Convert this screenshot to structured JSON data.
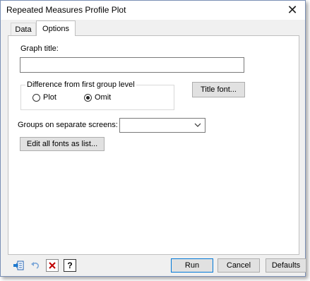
{
  "window": {
    "title": "Repeated Measures Profile Plot"
  },
  "tabs": [
    {
      "label": "Data",
      "active": false
    },
    {
      "label": "Options",
      "active": true
    }
  ],
  "options": {
    "graph_title_label": "Graph title:",
    "graph_title_value": "",
    "difference_group": {
      "legend": "Difference from first group level",
      "plot_label": "Plot",
      "omit_label": "Omit",
      "selected": "Omit"
    },
    "title_font_button": "Title font...",
    "groups_label": "Groups on separate screens:",
    "groups_value": "",
    "edit_fonts_button": "Edit all fonts as list..."
  },
  "footer": {
    "run_label": "Run",
    "cancel_label": "Cancel",
    "defaults_label": "Defaults"
  },
  "colors": {
    "accent": "#0078d7",
    "dialog_bg": "#f0f0f0",
    "panel_bg": "#ffffff",
    "cancel_x": "#c00000"
  }
}
